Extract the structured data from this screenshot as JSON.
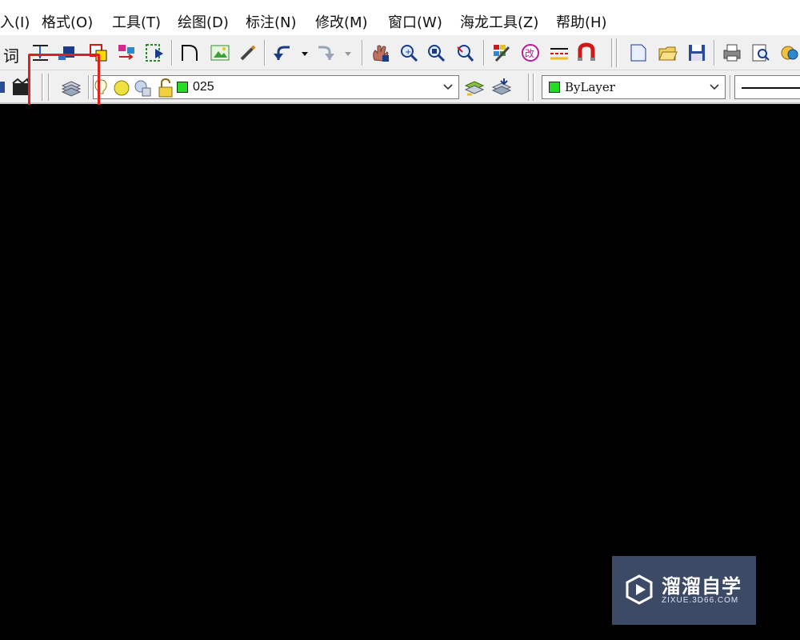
{
  "menu": {
    "items": [
      {
        "label": "入(I)"
      },
      {
        "label": "格式(O)"
      },
      {
        "label": "工具(T)"
      },
      {
        "label": "绘图(D)"
      },
      {
        "label": "标注(N)"
      },
      {
        "label": "修改(M)"
      },
      {
        "label": "窗口(W)"
      },
      {
        "label": "海龙工具(Z)"
      },
      {
        "label": "帮助(H)"
      }
    ]
  },
  "toolbar": {
    "partial_text": "词"
  },
  "layer_bar": {
    "layer_name": "025",
    "layer_color": "#22dd22",
    "color_value": "ByLayer",
    "color_swatch": "#22dd22"
  },
  "watermark": {
    "title": "溜溜自学",
    "subtitle": "ZIXUE.3D66.COM"
  },
  "colors": {
    "highlight": "#e0201a",
    "canvas": "#000000",
    "toolbar_bg": "#f0f0f0"
  }
}
